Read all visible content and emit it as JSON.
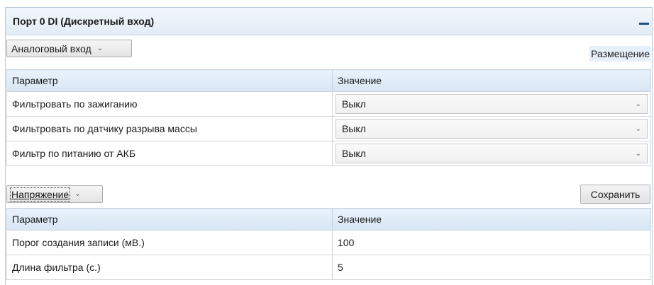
{
  "panel": {
    "title": "Порт 0 DI (Дискретный вход)"
  },
  "mode_dropdown": {
    "label": "Аналоговый вход"
  },
  "placement_label": "Размещение",
  "settings_table": {
    "headers": [
      "Параметр",
      "Значение"
    ],
    "rows": [
      {
        "param": "Фильтровать по зажиганию",
        "value": "Выкл"
      },
      {
        "param": "Фильтровать по датчику разрыва массы",
        "value": "Выкл"
      },
      {
        "param": "Фильтр по питанию от АКБ",
        "value": "Выкл"
      }
    ]
  },
  "voltage_dropdown": {
    "label": "Напряжение"
  },
  "save_button": {
    "label": "Сохранить"
  },
  "voltage_table": {
    "headers": [
      "Параметр",
      "Значение"
    ],
    "rows": [
      {
        "param": "Порог создания записи (мВ.)",
        "value": "100"
      },
      {
        "param": "Длина фильтра (с.)",
        "value": "5"
      }
    ]
  },
  "icons": {
    "collapse": "minus-icon",
    "dropdown": "chevron-down-icon"
  }
}
